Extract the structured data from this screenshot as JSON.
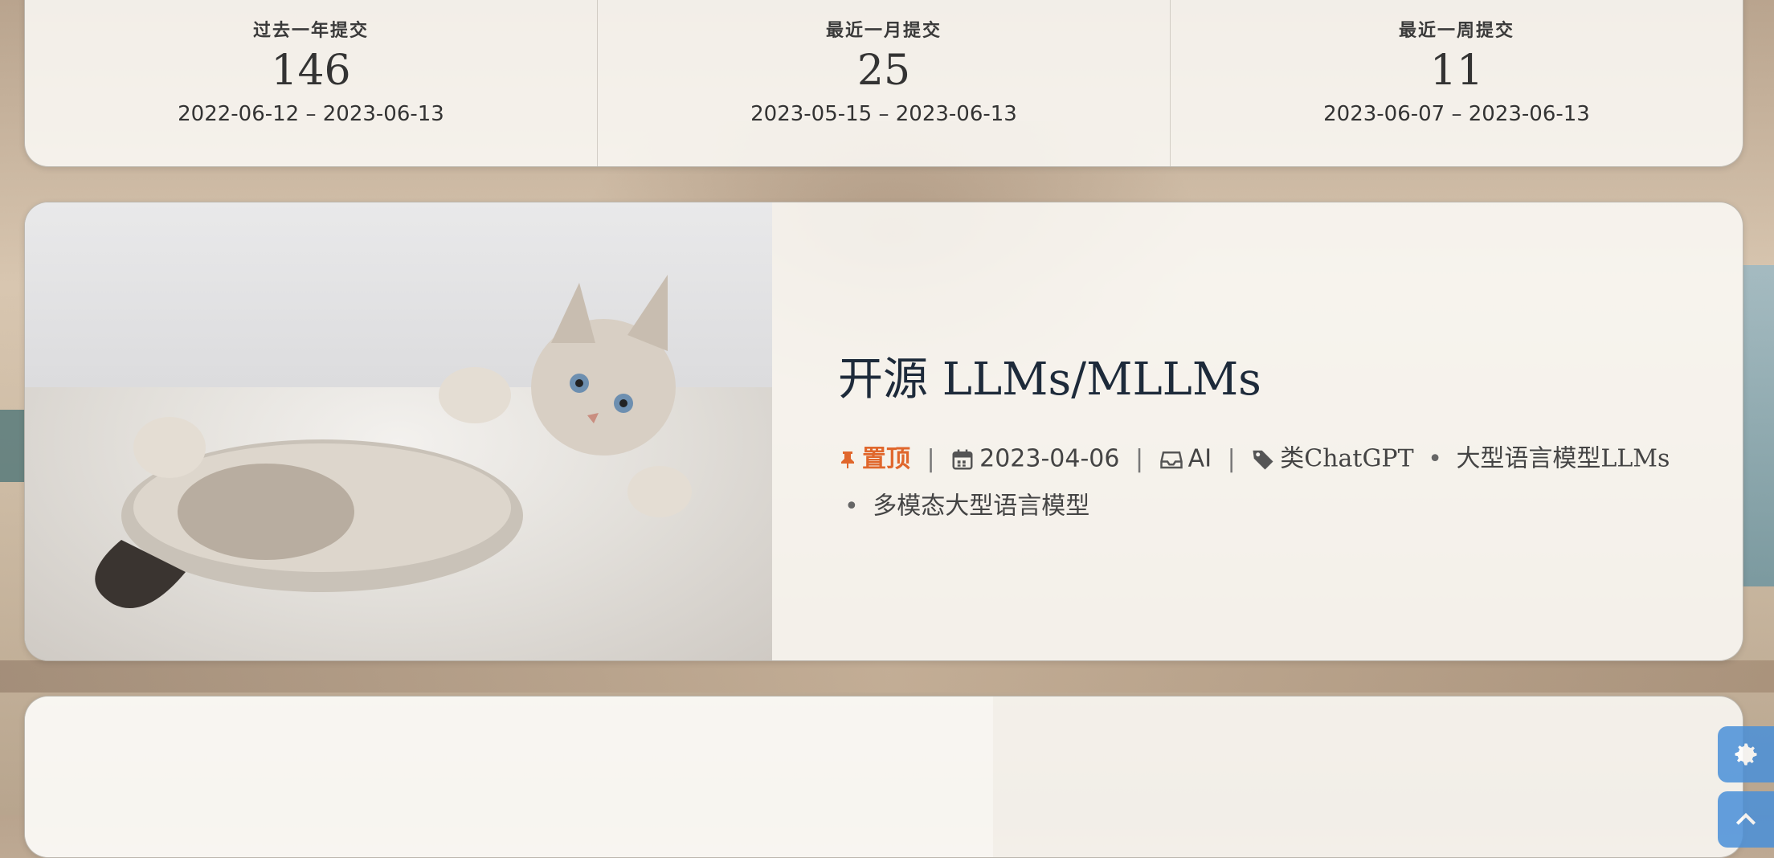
{
  "stats": [
    {
      "title": "过去一年提交",
      "value": "146",
      "range": "2022-06-12 – 2023-06-13"
    },
    {
      "title": "最近一月提交",
      "value": "25",
      "range": "2023-05-15 – 2023-06-13"
    },
    {
      "title": "最近一周提交",
      "value": "11",
      "range": "2023-06-07 – 2023-06-13"
    }
  ],
  "post": {
    "title": "开源 LLMs/MLLMs",
    "pinned_label": "置顶",
    "date": "2023-04-06",
    "category": "AI",
    "tags": [
      "类ChatGPT",
      "大型语言模型LLMs",
      "多模态大型语言模型"
    ]
  },
  "icons": {
    "pin": "pushpin-icon",
    "calendar": "calendar-icon",
    "category": "inbox-icon",
    "tags": "tag-icon",
    "settings": "gear-icon",
    "top": "arrow-up-icon"
  },
  "colors": {
    "accent": "#e0672c",
    "title": "#1d2a3a",
    "fab": "#4a90d9"
  }
}
